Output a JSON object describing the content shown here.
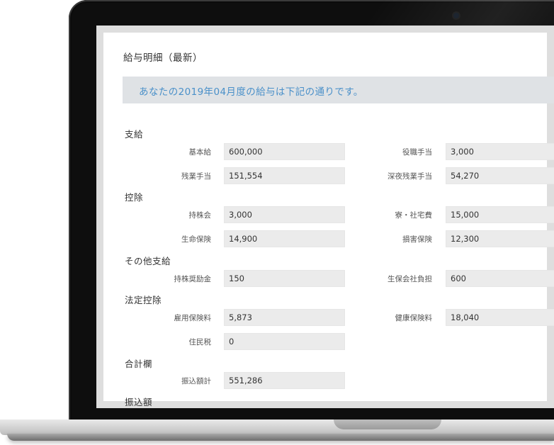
{
  "page": {
    "title": "給与明細（最新）",
    "notice": "あなたの2019年04月度の給与は下記の通りです。"
  },
  "sections": {
    "payments": {
      "title": "支給",
      "base_salary": {
        "label": "基本給",
        "value": "600,000"
      },
      "position_allowance": {
        "label": "役職手当",
        "value": "3,000"
      },
      "overtime_allowance": {
        "label": "残業手当",
        "value": "151,554"
      },
      "late_night_overtime": {
        "label": "深夜残業手当",
        "value": "54,270"
      }
    },
    "deductions": {
      "title": "控除",
      "stock_ownership": {
        "label": "持株会",
        "value": "3,000"
      },
      "dorm_housing": {
        "label": "寮・社宅費",
        "value": "15,000"
      },
      "life_insurance": {
        "label": "生命保険",
        "value": "14,900"
      },
      "damage_insurance": {
        "label": "損害保険",
        "value": "12,300"
      }
    },
    "other_payments": {
      "title": "その他支給",
      "stock_incentive": {
        "label": "持株奨励金",
        "value": "150"
      },
      "life_ins_company_share": {
        "label": "生保会社負担",
        "value": "600"
      }
    },
    "statutory_deductions": {
      "title": "法定控除",
      "employment_insurance": {
        "label": "雇用保険料",
        "value": "5,873"
      },
      "health_insurance": {
        "label": "健康保険料",
        "value": "18,040"
      },
      "resident_tax": {
        "label": "住民税",
        "value": "0"
      }
    },
    "totals": {
      "title": "合計欄",
      "transfer_total": {
        "label": "振込額計",
        "value": "551,286"
      }
    },
    "transfer": {
      "title": "振込額"
    }
  }
}
